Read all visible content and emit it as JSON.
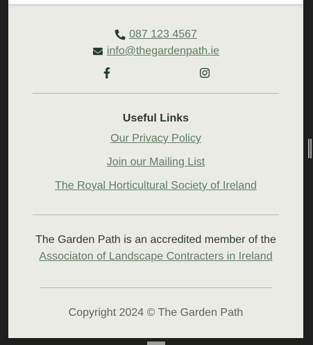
{
  "contact": {
    "phone": "087 123 4567",
    "email": "info@thegardenpath.ie",
    "phone_icon": "phone-icon",
    "email_icon": "envelope-icon"
  },
  "social": {
    "facebook_icon": "facebook-icon",
    "instagram_icon": "instagram-icon"
  },
  "useful_links": {
    "title": "Useful Links",
    "items": [
      {
        "label": "Our Privacy Policy"
      },
      {
        "label": "Join our Mailing List"
      },
      {
        "label": "The Royal Horticultural Society of Ireland"
      }
    ]
  },
  "membership": {
    "text": "The Garden Path is an accredited member of the",
    "link": "Associaton of Landscape Contracters in Ireland"
  },
  "footer": {
    "copyright": "Copyright 2024 © The Garden Path"
  },
  "colors": {
    "page_bg": "#ebebe6",
    "link": "#5e7d62",
    "icon": "#243b2a",
    "divider": "#b7b8b2"
  }
}
